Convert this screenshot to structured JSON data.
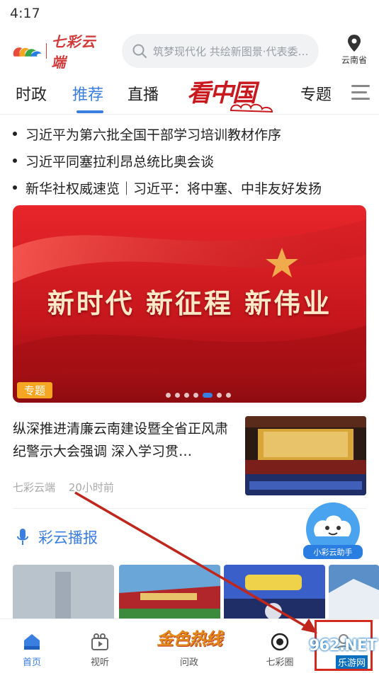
{
  "status_bar": {
    "time": "4:17"
  },
  "header": {
    "logo_text": "七彩云端",
    "search_placeholder": "筑梦现代化 共绘新图景·代表委…",
    "location_label": "云南省"
  },
  "tabs": {
    "items": [
      {
        "label": "时政"
      },
      {
        "label": "推荐",
        "active": true
      },
      {
        "label": "直播"
      },
      {
        "label": "看中国"
      },
      {
        "label": "专题"
      }
    ]
  },
  "headlines": [
    "习近平为第六批全国干部学习培训教材作序",
    "习近平同塞拉利昂总统比奥会谈",
    "新华社权威速览｜习近平：将中塞、中非友好发扬"
  ],
  "banner": {
    "title": "新时代 新征程 新伟业",
    "tag": "专题",
    "slide_count": 7,
    "active_slide": 5
  },
  "news_item": {
    "title": "纵深推进清廉云南建设暨全省正风肃纪警示大会强调 深入学习贯…",
    "source": "七彩云端",
    "time": "20小时前"
  },
  "broadcast": {
    "label": "彩云播报"
  },
  "assistant": {
    "label": "小彩云助手"
  },
  "bottom_nav": {
    "items": [
      {
        "label": "首页",
        "active": true
      },
      {
        "label": "视听"
      },
      {
        "label": "问政"
      },
      {
        "label": "七彩圈"
      },
      {
        "label": ""
      }
    ],
    "hotline_logo": "金色热线"
  },
  "watermark": {
    "text": "962.NET",
    "sub": "乐游网"
  },
  "colors": {
    "accent": "#3a7ee0",
    "highlight": "#d42a1f",
    "banner_red": "#c4161c"
  }
}
